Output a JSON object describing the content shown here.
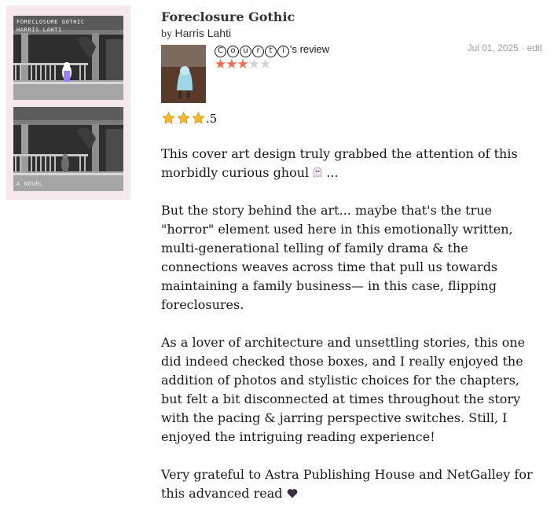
{
  "book": {
    "title": "Foreclosure Gothic",
    "by_prefix": "by",
    "author": "Harris Lahti",
    "cover": {
      "title_text": "FORECLOSURE GOTHIC",
      "author_text": "HARRIS LAHTI",
      "footer_text": "A NOVEL"
    }
  },
  "review": {
    "reviewer_letters": [
      "C",
      "o",
      "u",
      "r",
      "t",
      "i"
    ],
    "reviewer_suffix": "'s review",
    "stars_filled": 3,
    "stars_total": 5,
    "date": "Jul 01, 2025",
    "separator": "·",
    "edit_label": "edit",
    "rating_suffix": ".5",
    "rating_icon": "gold-star-emoji",
    "paragraphs": {
      "p1": "This cover art design truly grabbed the attention of this morbidly curious ghoul",
      "p1_end": "...",
      "p2": "But the story behind the art... maybe that's the true \"horror\" element used here in this emotionally written, multi-generational telling of family drama & the connections weaves across time that pull us towards maintaining a family business— in this case, flipping foreclosures.",
      "p3": "As a lover of architecture and unsettling stories, this one did indeed checked those boxes, and I really enjoyed the addition of photos and stylistic choices for the chapters, but felt a bit disconnected at times throughout the story with the pacing & jarring perspective switches. Still, I enjoyed the intriguing reading experience!",
      "p4": "Very grateful to Astra Publishing House and NetGalley for this advanced read"
    }
  },
  "colors": {
    "star_filled": "#f26a53",
    "star_empty": "#d3d3d3",
    "meta_text": "#9a9a9a",
    "cover_bg": "#f6e8ec"
  }
}
